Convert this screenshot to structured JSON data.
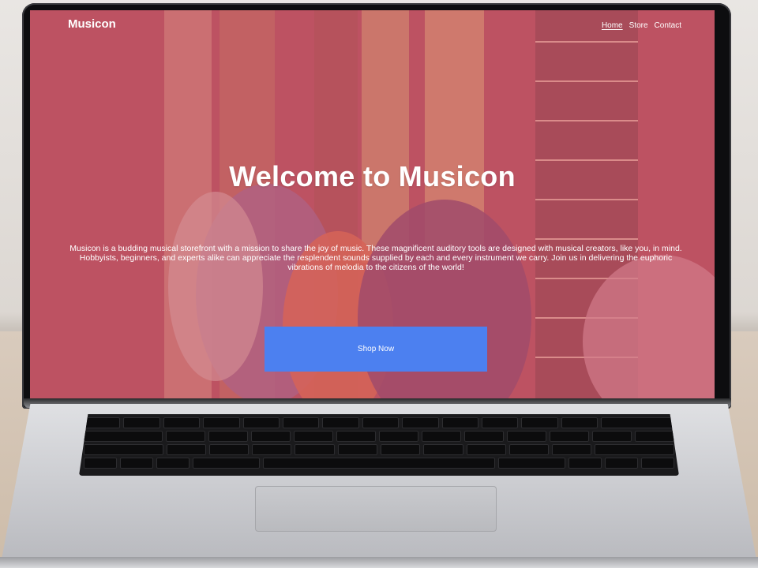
{
  "site": {
    "brand": "Musicon",
    "nav": [
      {
        "label": "Home",
        "active": true
      },
      {
        "label": "Store",
        "active": false
      },
      {
        "label": "Contact",
        "active": false
      }
    ]
  },
  "hero": {
    "title": "Welcome to Musicon",
    "description": "Musicon is a budding musical storefront with a mission to share the joy of music. These magnificent auditory tools are designed with musical creators, like you, in mind. Hobbyists, beginners, and experts alike can appreciate the resplendent sounds supplied by each and every instrument we carry. Join us in delivering the euphoric vibrations of melodia to the citizens of the world!",
    "cta_label": "Shop Now"
  },
  "colors": {
    "overlay": "#cd5a6c",
    "cta": "#4c80f0",
    "text": "#ffffff"
  }
}
